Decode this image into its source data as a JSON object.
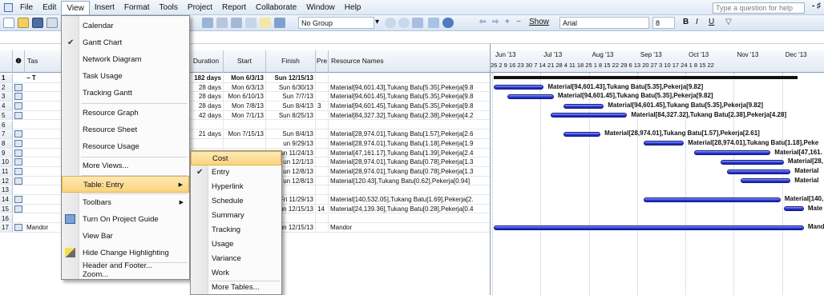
{
  "menubar": {
    "items": [
      "File",
      "Edit",
      "View",
      "Insert",
      "Format",
      "Tools",
      "Project",
      "Report",
      "Collaborate",
      "Window",
      "Help"
    ],
    "help_placeholder": "Type a question for help"
  },
  "toolbar": {
    "group": "No Group",
    "show_label": "Show",
    "font": "Arial",
    "size": "8",
    "bold": "B",
    "italic": "I",
    "underline": "U"
  },
  "grid": {
    "headers": {
      "task": "Tas",
      "duration": "Duration",
      "start": "Start",
      "finish": "Finish",
      "pred": "Pre",
      "resources": "Resource Names"
    },
    "rows": [
      {
        "n": "1",
        "name": "− T",
        "duration": "182 days",
        "start": "Mon 6/3/13",
        "finish": "Sun 12/15/13",
        "pred": "",
        "res": "",
        "bold": true
      },
      {
        "n": "2",
        "duration": "28 days",
        "start": "Mon 6/3/13",
        "finish": "Sun 6/30/13",
        "pred": "",
        "res": "Material[94,601.43],Tukang Batu[5.35],Pekerja[9.8"
      },
      {
        "n": "3",
        "duration": "28 days",
        "start": "Mon 6/10/13",
        "finish": "Sun 7/7/13",
        "pred": "",
        "res": "Material[94,601.45],Tukang Batu[5.35],Pekerja[9.8"
      },
      {
        "n": "4",
        "duration": "28 days",
        "start": "Mon 7/8/13",
        "finish": "Sun 8/4/13",
        "pred": "3",
        "res": "Material[94,601.45],Tukang Batu[5.35],Pekerja[9.8"
      },
      {
        "n": "5",
        "duration": "42 days",
        "start": "Mon 7/1/13",
        "finish": "Sun 8/25/13",
        "pred": "",
        "res": "Material[84,327.32],Tukang Batu[2.38],Pekerja[4.2"
      },
      {
        "n": "6",
        "duration": "",
        "start": "",
        "finish": "",
        "pred": "",
        "res": ""
      },
      {
        "n": "7",
        "duration": "21 days",
        "start": "Mon 7/15/13",
        "finish": "Sun 8/4/13",
        "pred": "",
        "res": "Material[28,974.01],Tukang Batu[1.57],Pekerja[2.6"
      },
      {
        "n": "8",
        "duration": "",
        "start": "",
        "finish": "un 9/29/13",
        "pred": "",
        "res": "Material[28,974.01],Tukang Batu[1.18],Pekerja[1.9"
      },
      {
        "n": "9",
        "duration": "",
        "start": "",
        "finish": "un 11/24/13",
        "pred": "",
        "res": "Material[47,161.17],Tukang Batu[1.39],Pekerja[2.4"
      },
      {
        "n": "10",
        "duration": "",
        "start": "",
        "finish": "un 12/1/13",
        "pred": "",
        "res": "Material[28,974.01],Tukang Batu[0.78],Pekerja[1.3"
      },
      {
        "n": "11",
        "duration": "",
        "start": "",
        "finish": "un 12/8/13",
        "pred": "",
        "res": "Material[28,974.01],Tukang Batu[0.78],Pekerja[1.3"
      },
      {
        "n": "12",
        "duration": "",
        "start": "",
        "finish": "un 12/8/13",
        "pred": "",
        "res": "Material[120.43],Tukang Batu[0.62],Pekerja[0.94]"
      },
      {
        "n": "13",
        "duration": "",
        "start": "",
        "finish": "",
        "pred": "",
        "res": ""
      },
      {
        "n": "14",
        "duration": "",
        "start": "",
        "finish": "Fri 11/29/13",
        "pred": "",
        "res": "Material[140,532.05],Tukang Batu[1.69],Pekerja[2."
      },
      {
        "n": "15",
        "duration": "",
        "start": "",
        "finish": "un 12/15/13",
        "pred": "14",
        "res": "Material[24,139.36],Tukang Batu[0.28],Pekerja[0.4"
      },
      {
        "n": "16",
        "duration": "",
        "start": "",
        "finish": "",
        "pred": "",
        "res": ""
      },
      {
        "n": "17",
        "name": "Mandor",
        "duration": "",
        "start": "",
        "finish": "un 12/15/13",
        "pred": "",
        "res": "Mandor"
      }
    ]
  },
  "gantt": {
    "months": [
      "Jun '13",
      "Jul '13",
      "Aug '13",
      "Sep '13",
      "Oct '13",
      "Nov '13",
      "Dec '13"
    ],
    "days": "26 2 9 16 23 30 7 14 21 28 4 11 18 25 1 8 15 22 29 6 13 20 27 3 10 17 24 1 8 15 22",
    "labels": [
      "Material[94,601.43],Tukang Batu[5.35],Pekerja[9.82]",
      "Material[94,601.45],Tukang Batu[5.35],Pekerja[9.82]",
      "Material[94,601.45],Tukang Batu[5.35],Pekerja[9.82]",
      "Material[84,327.32],Tukang Batu[2.38],Pekerja[4.28]",
      "Material[28,974.01],Tukang Batu[1.57],Pekerja[2.61]",
      "Material[28,974.01],Tukang Batu[1.18],Peke",
      "Material[47,161.",
      "Material[28,",
      "Material",
      "Material",
      "Material[140,",
      "Mate",
      "Mand"
    ],
    "bars": [
      {
        "row": 1,
        "start": 0.0,
        "end": 0.91,
        "summary": true
      },
      {
        "row": 2,
        "start": 0.0,
        "end": 0.15,
        "label": 0
      },
      {
        "row": 3,
        "start": 0.04,
        "end": 0.18,
        "label": 1
      },
      {
        "row": 4,
        "start": 0.21,
        "end": 0.33,
        "label": 2
      },
      {
        "row": 5,
        "start": 0.17,
        "end": 0.4,
        "label": 3
      },
      {
        "row": 7,
        "start": 0.21,
        "end": 0.32,
        "label": 4
      },
      {
        "row": 8,
        "start": 0.45,
        "end": 0.57,
        "label": 5
      },
      {
        "row": 9,
        "start": 0.6,
        "end": 0.83,
        "label": 6
      },
      {
        "row": 10,
        "start": 0.68,
        "end": 0.87,
        "label": 7
      },
      {
        "row": 11,
        "start": 0.7,
        "end": 0.89,
        "label": 8
      },
      {
        "row": 12,
        "start": 0.74,
        "end": 0.89,
        "label": 9
      },
      {
        "row": 14,
        "start": 0.45,
        "end": 0.86,
        "label": 10
      },
      {
        "row": 15,
        "start": 0.87,
        "end": 0.93,
        "label": 11
      },
      {
        "row": 17,
        "start": 0.0,
        "end": 0.93,
        "label": 12
      }
    ]
  },
  "view_menu": {
    "items": [
      "Calendar",
      "Gantt Chart",
      "Network Diagram",
      "Task Usage",
      "Tracking Gantt",
      "Resource Graph",
      "Resource Sheet",
      "Resource Usage",
      "More Views...",
      "Table: Entry",
      "Toolbars",
      "Turn On Project Guide",
      "View Bar",
      "Hide Change Highlighting",
      "Header and Footer...",
      "Zoom..."
    ]
  },
  "table_menu": {
    "items": [
      "Cost",
      "Entry",
      "Hyperlink",
      "Schedule",
      "Summary",
      "Tracking",
      "Usage",
      "Variance",
      "Work",
      "More Tables..."
    ]
  },
  "colors": {
    "bar": "#2b37d8",
    "highlight": "#f9d47a"
  }
}
